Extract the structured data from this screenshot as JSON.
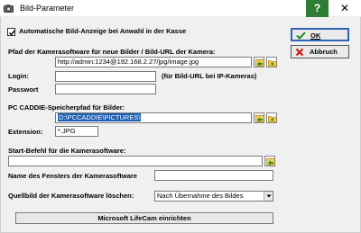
{
  "window": {
    "title": "Bild-Parameter",
    "help_label": "?",
    "close_label": "✕"
  },
  "auto_display": {
    "label": "Automatische Bild-Anzeige bei Anwahl in der Kasse",
    "checked": true
  },
  "camera_path": {
    "label": "Pfad der Kamerasoftware für neue Bilder / Bild-URL der Kamera:",
    "value": "http://admin:1234@192.168.2.27/jpg/image.jpg"
  },
  "login": {
    "label": "Login:",
    "value": "",
    "hint": "(für Bild-URL bei IP-Kameras)"
  },
  "password": {
    "label": "Passwort",
    "value": ""
  },
  "storage_path": {
    "label": "PC CADDIE-Speicherpfad für Bilder:",
    "value": "D:\\PCCADDIE\\PICTURES\\"
  },
  "extension": {
    "label": "Extension:",
    "value": "*.JPG"
  },
  "start_command": {
    "label": "Start-Befehl für die Kamerasoftware:",
    "value": ""
  },
  "window_name": {
    "label": "Name des Fensters der Kamerasoftware",
    "value": ""
  },
  "delete_source": {
    "label": "Quellbild der Kamerasoftware löschen:",
    "selected": "Nach Übernahme des Bildes"
  },
  "lifecam_button": {
    "label": "Microsoft LifeCam einrichten"
  },
  "buttons": {
    "ok": "OK",
    "cancel": "Abbruch"
  },
  "colors": {
    "help_bg": "#2e7d32",
    "selection": "#1c5fb4",
    "ok_border": "#2f64b8"
  },
  "icons": [
    "camera-icon",
    "check-icon",
    "cross-icon",
    "run-icon",
    "folder-icon",
    "chevron-down-icon"
  ]
}
